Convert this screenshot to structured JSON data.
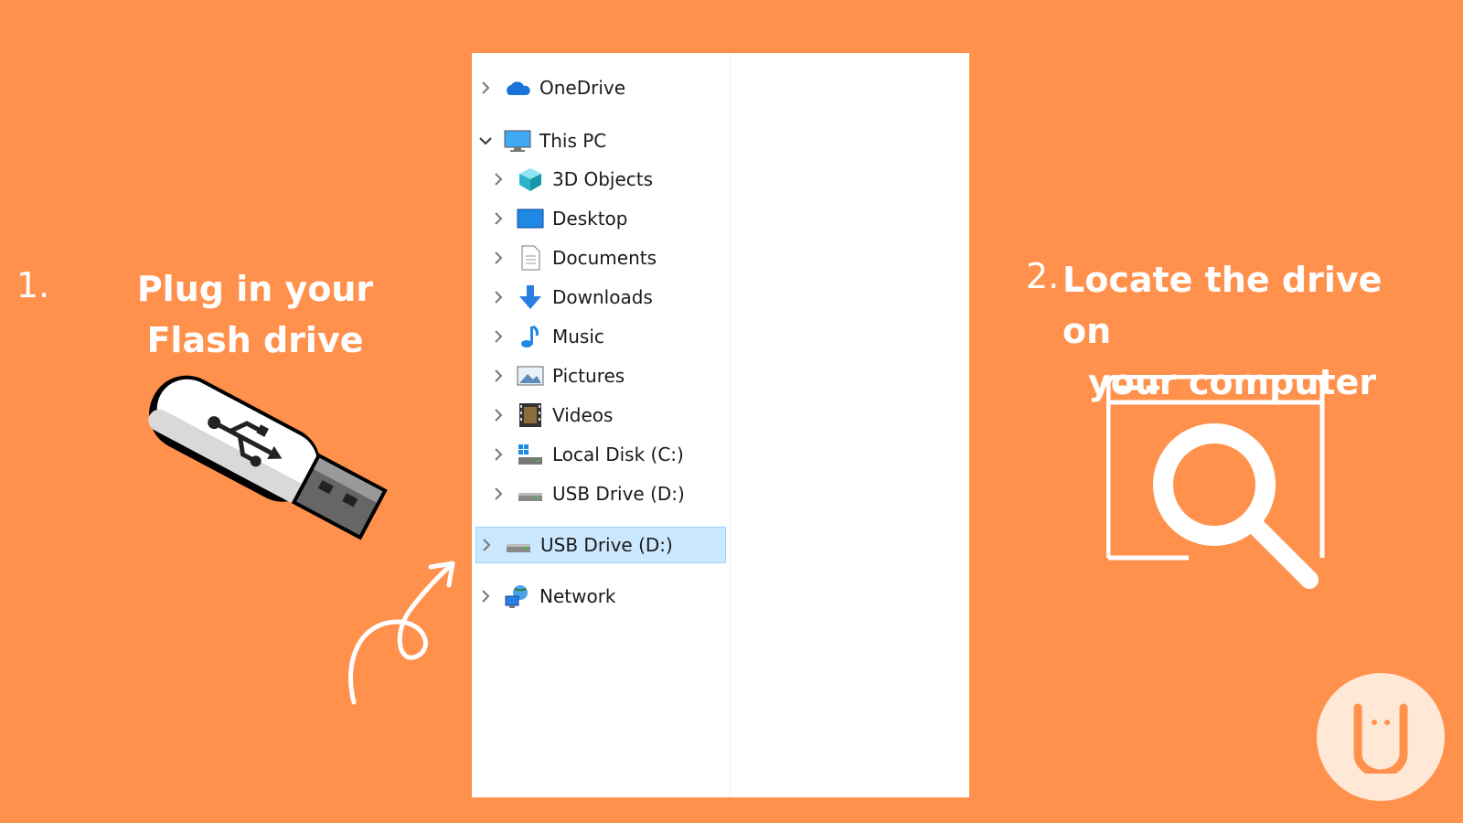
{
  "step1": {
    "number": "1.",
    "text": "Plug in your Flash drive"
  },
  "step2": {
    "number": "2.",
    "text_line1": "Locate the drive on",
    "text_line2": "your computer"
  },
  "explorer": {
    "items": [
      {
        "label": "OneDrive",
        "icon": "onedrive-icon",
        "chevron": "right",
        "level": 0
      },
      {
        "label": "This PC",
        "icon": "this-pc-icon",
        "chevron": "down",
        "level": 0
      },
      {
        "label": "3D Objects",
        "icon": "3d-objects-icon",
        "chevron": "right",
        "level": 1
      },
      {
        "label": "Desktop",
        "icon": "desktop-icon",
        "chevron": "right",
        "level": 1
      },
      {
        "label": "Documents",
        "icon": "documents-icon",
        "chevron": "right",
        "level": 1
      },
      {
        "label": "Downloads",
        "icon": "downloads-icon",
        "chevron": "right",
        "level": 1
      },
      {
        "label": "Music",
        "icon": "music-icon",
        "chevron": "right",
        "level": 1
      },
      {
        "label": "Pictures",
        "icon": "pictures-icon",
        "chevron": "right",
        "level": 1
      },
      {
        "label": "Videos",
        "icon": "videos-icon",
        "chevron": "right",
        "level": 1
      },
      {
        "label": "Local Disk (C:)",
        "icon": "local-disk-icon",
        "chevron": "right",
        "level": 1
      },
      {
        "label": "USB Drive (D:)",
        "icon": "usb-drive-icon",
        "chevron": "right",
        "level": 1
      },
      {
        "label": "USB Drive (D:)",
        "icon": "usb-drive-icon",
        "chevron": "right",
        "level": 0,
        "selected": true
      },
      {
        "label": "Network",
        "icon": "network-icon",
        "chevron": "right",
        "level": 0
      }
    ]
  },
  "colors": {
    "background": "#FF914D",
    "selection": "#CCE8FF",
    "selection_border": "#99D1FF",
    "text": "#FFFFFF"
  },
  "illustrations": {
    "usb": "usb-flash-drive-icon",
    "search": "browser-search-icon",
    "arrow": "curved-arrow-icon",
    "logo": "logo-icon"
  }
}
